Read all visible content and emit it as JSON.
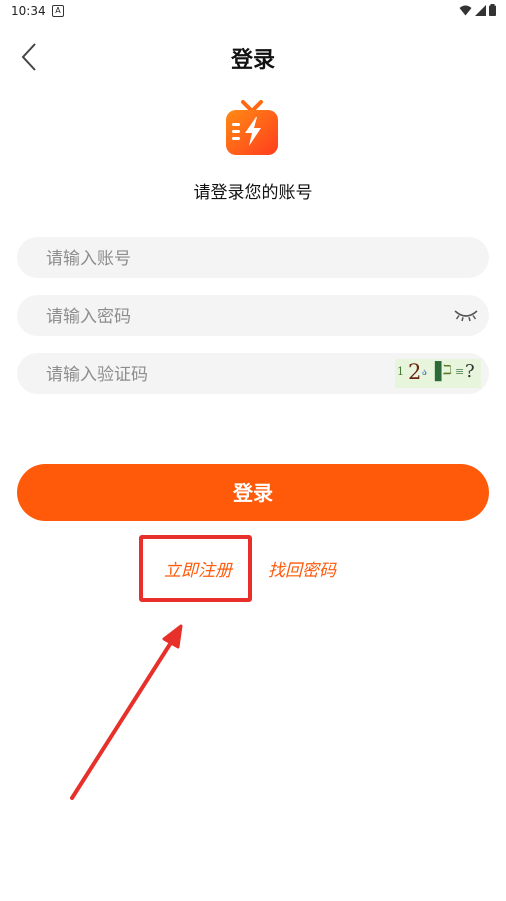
{
  "status_bar": {
    "time": "10:34",
    "notification_icon": "A"
  },
  "header": {
    "title": "登录",
    "back_icon": "chevron-left-icon"
  },
  "logo": {
    "icon": "tv-lightning-logo",
    "accent_color": "#ff5a0a"
  },
  "subtitle": "请登录您的账号",
  "form": {
    "account_placeholder": "请输入账号",
    "password_placeholder": "请输入密码",
    "captcha_placeholder": "请输入验证码",
    "eye_icon": "eye-closed-icon"
  },
  "login_button": "登录",
  "links": {
    "register": "立即注册",
    "forgot_password": "找回密码"
  },
  "colors": {
    "primary": "#ff5a0a",
    "annotation": "#e8302a",
    "field_bg": "#f4f4f4"
  }
}
